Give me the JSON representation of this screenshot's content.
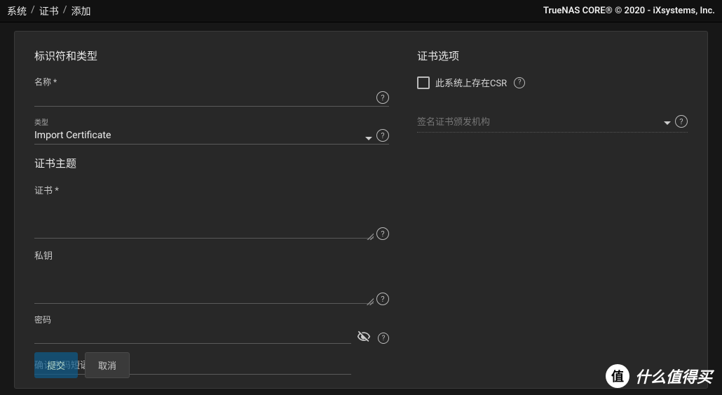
{
  "breadcrumb": {
    "a": "系统",
    "b": "证书",
    "c": "添加",
    "sep": "/"
  },
  "copyright": "TrueNAS CORE® © 2020 - iXsystems, Inc.",
  "left": {
    "section_title": "标识符和类型",
    "name_label": "名称 *",
    "type_small": "类型",
    "type_value": "Import Certificate",
    "subject_title": "证书主题",
    "cert_label": "证书 *",
    "key_label": "私钥",
    "pwd_label": "密码",
    "confirm_pwd": "确认密码短语"
  },
  "right": {
    "section_title": "证书选项",
    "csr_label": "此系统上存在CSR",
    "signing_placeholder": "签名证书颁发机构"
  },
  "buttons": {
    "submit": "提交",
    "cancel": "取消"
  },
  "watermark": {
    "badge": "值",
    "text": "什么值得买"
  },
  "help": "?"
}
